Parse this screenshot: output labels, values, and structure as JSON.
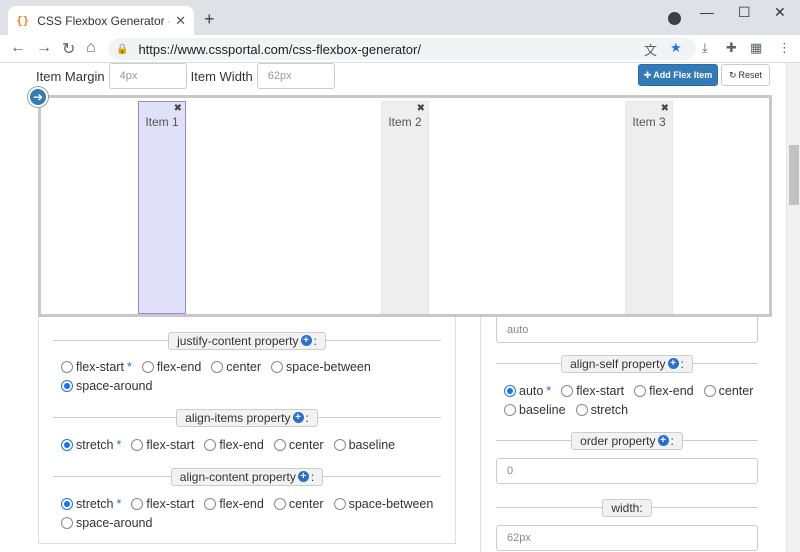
{
  "browser": {
    "tab_title": "CSS Flexbox Generator - CSS Po",
    "favicon": "{}",
    "url": "https://www.cssportal.com/css-flexbox-generator/"
  },
  "toolbar": {
    "item_margin_label": "Item Margin",
    "item_margin_placeholder": "4px",
    "item_width_label": "Item Width",
    "item_width_placeholder": "62px",
    "add_button": "Add Flex Item",
    "reset_button": "Reset"
  },
  "items": [
    {
      "label": "Item 1",
      "selected": true
    },
    {
      "label": "Item 2",
      "selected": false
    },
    {
      "label": "Item 3",
      "selected": false
    }
  ],
  "left_panel": {
    "justify_content": {
      "title": "justify-content property",
      "options": [
        "flex-start",
        "flex-end",
        "center",
        "space-between",
        "space-around"
      ],
      "selected": "space-around"
    },
    "align_items": {
      "title": "align-items property",
      "options": [
        "stretch",
        "flex-start",
        "flex-end",
        "center",
        "baseline"
      ],
      "selected": "stretch"
    },
    "align_content": {
      "title": "align-content property",
      "options": [
        "stretch",
        "flex-start",
        "flex-end",
        "center",
        "space-between",
        "space-around"
      ],
      "selected": "stretch"
    }
  },
  "right_panel": {
    "flex_basis_value": "auto",
    "align_self": {
      "title": "align-self property",
      "options": [
        "auto",
        "flex-start",
        "flex-end",
        "center",
        "baseline",
        "stretch"
      ],
      "selected": "auto"
    },
    "order": {
      "title": "order property",
      "value": "0"
    },
    "width": {
      "title": "width:",
      "value": "62px"
    }
  },
  "colors": {
    "accent": "#337ab7",
    "selected_item": "#e0e0f8",
    "radio": "#1a73e8"
  }
}
